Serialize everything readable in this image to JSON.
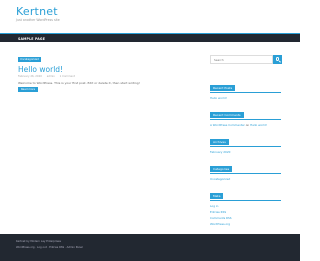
{
  "header": {
    "title": "Kertnet",
    "description": "Just another WordPress site"
  },
  "nav": {
    "items": [
      "SAMPLE PAGE"
    ]
  },
  "post": {
    "category": "Uncategorized",
    "title": "Hello world!",
    "date": "February 26, 2020",
    "author": "admin",
    "comments": "1 Comment",
    "excerpt": "Welcome to WordPress. This is your first post. Edit or delete it, then start writing!",
    "read_more": "Read more"
  },
  "sidebar": {
    "search_placeholder": "Search",
    "recent_posts": {
      "title": "Recent Posts",
      "items": [
        "Hello world!"
      ]
    },
    "recent_comments": {
      "title": "Recent Comments",
      "author": "A WordPress Commenter",
      "on": "on",
      "post": "Hello world!"
    },
    "archives": {
      "title": "Archives",
      "items": [
        "February 2020"
      ]
    },
    "categories": {
      "title": "Categories",
      "items": [
        "Uncategorized"
      ]
    },
    "meta": {
      "title": "Meta",
      "items": [
        "Log in",
        "Entries RSS",
        "Comments RSS",
        "WordPress.org"
      ]
    }
  },
  "footer": {
    "line1": "Kertnet by Modern Lay Enterprises",
    "line2": "WordPress.org · Log out · Entries RSS · Admin Panel"
  },
  "colors": {
    "accent": "#2a9fd6",
    "dark": "#222831"
  }
}
